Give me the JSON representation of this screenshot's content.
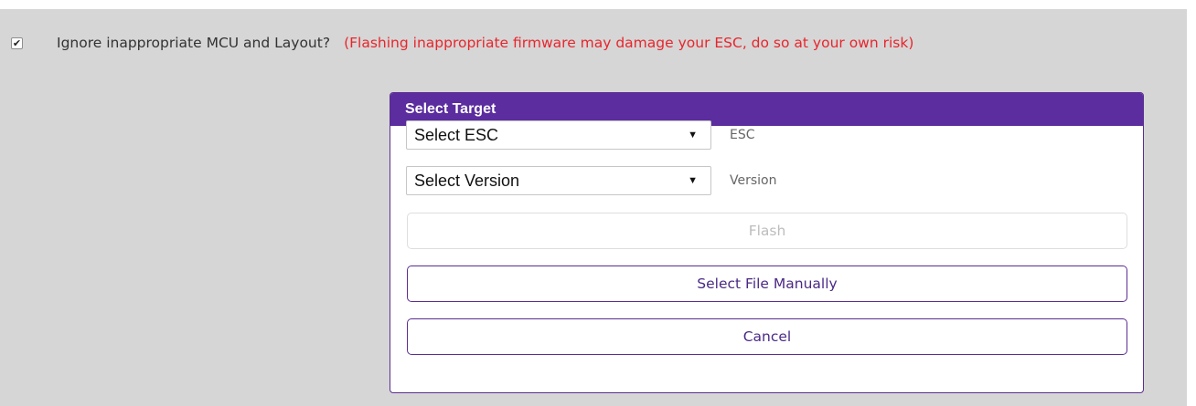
{
  "options": {
    "ignore_checked": true,
    "ignore_label": "Ignore inappropriate MCU and Layout?",
    "warning_text": "(Flashing inappropriate firmware may damage your ESC, do so at your own risk)"
  },
  "dialog": {
    "title": "Select Target",
    "esc_select": {
      "value": "Select ESC",
      "label": "ESC"
    },
    "version_select": {
      "value": "Select Version",
      "label": "Version"
    },
    "flash_button": "Flash",
    "select_file_button": "Select File Manually",
    "cancel_button": "Cancel"
  },
  "colors": {
    "accent": "#5b2d9e",
    "warning": "#e8262c",
    "panel_bg": "#d6d6d6"
  }
}
